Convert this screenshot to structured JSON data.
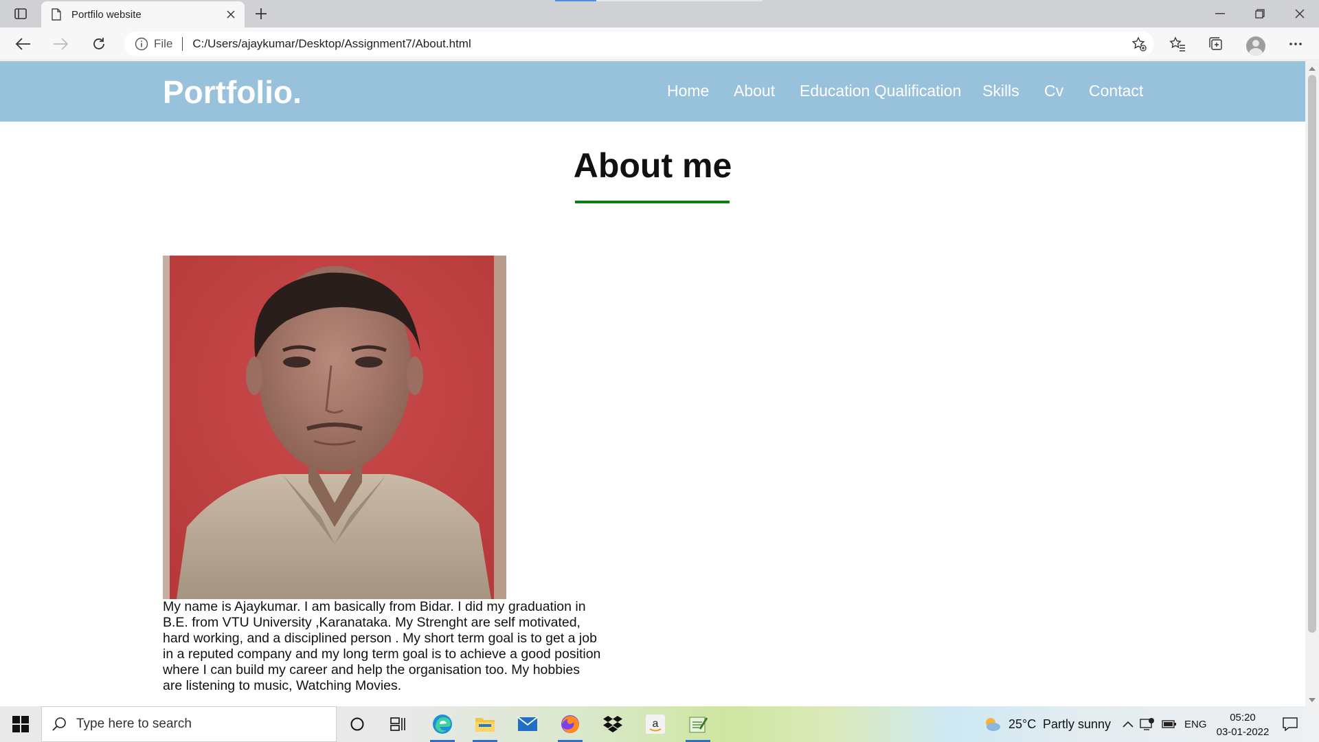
{
  "browser": {
    "tab_title": "Portfilo website",
    "address_scheme": "File",
    "address_url": "C:/Users/ajaykumar/Desktop/Assignment7/About.html"
  },
  "site": {
    "brand": "Portfolio.",
    "nav": [
      "Home",
      "About",
      "Education Qualification",
      "Skills",
      "Cv",
      "Contact"
    ],
    "heading": "About me",
    "bio": "My name is Ajaykumar. I am basically from Bidar. I did my graduation in B.E. from VTU University ,Karanataka. My Strenght are self motivated, hard working, and a disciplined person . My short term goal is to get a job in a reputed company and my long term goal is to achieve a good position where I can build my career and help the organisation too. My hobbies are listening to music, Watching Movies.",
    "colors": {
      "header_bg": "#98c1dc",
      "underline": "#0a7d14"
    }
  },
  "taskbar": {
    "search_placeholder": "Type here to search",
    "weather_temp": "25°C",
    "weather_desc": "Partly sunny",
    "language": "ENG",
    "time": "05:20",
    "date": "03-01-2022"
  }
}
